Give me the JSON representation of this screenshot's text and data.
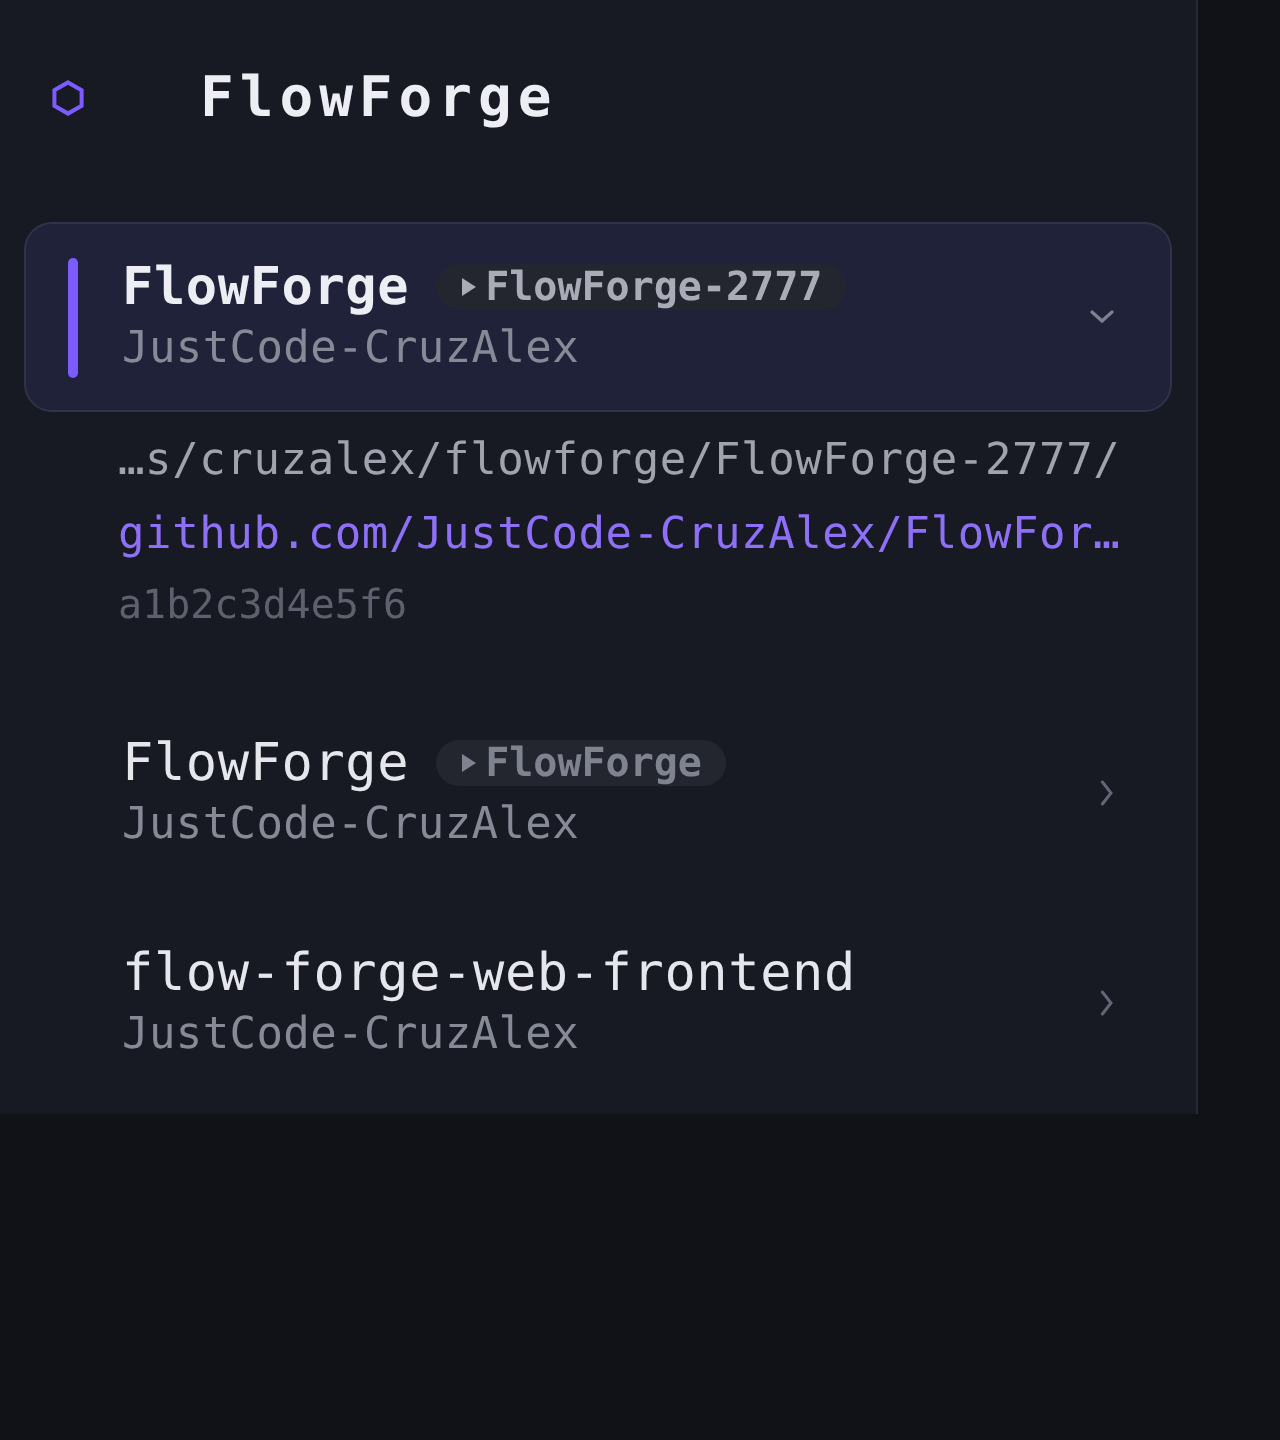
{
  "header": {
    "title": "FlowForge"
  },
  "projects": [
    {
      "name": "FlowForge",
      "branch": "FlowForge-2777",
      "owner": "JustCode-CruzAlex",
      "selected": true,
      "expanded": true,
      "details": {
        "path": "…s/cruzalex/flowforge/FlowForge-2777/",
        "url": "github.com/JustCode-CruzAlex/FlowFor…",
        "commit": "a1b2c3d4e5f6"
      }
    },
    {
      "name": "FlowForge",
      "branch": "FlowForge",
      "owner": "JustCode-CruzAlex",
      "selected": false,
      "expanded": false
    },
    {
      "name": "flow-forge-web-frontend",
      "owner": "JustCode-CruzAlex",
      "selected": false,
      "expanded": false
    }
  ]
}
